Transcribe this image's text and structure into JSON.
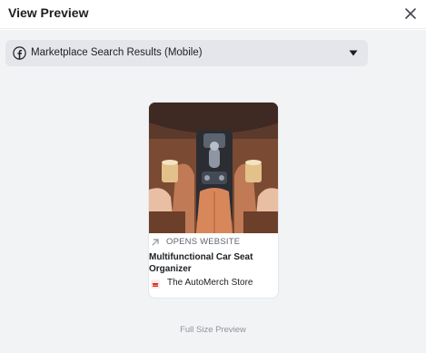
{
  "header": {
    "title": "View Preview"
  },
  "placement": {
    "selected": "Marketplace Search Results (Mobile)"
  },
  "ad": {
    "image_icon": "car-console-organizer-photo",
    "cta_label": "OPENS WEBSITE",
    "product_title": "Multifunctional Car Seat Organizer",
    "store_name": "The AutoMerch Store"
  },
  "footer": {
    "link_label": "Full Size Preview"
  },
  "colors": {
    "accent_text": "#1c1e21",
    "muted_text": "#606770",
    "panel_bg": "#f2f3f5",
    "dropdown_bg": "#e4e6eb"
  }
}
